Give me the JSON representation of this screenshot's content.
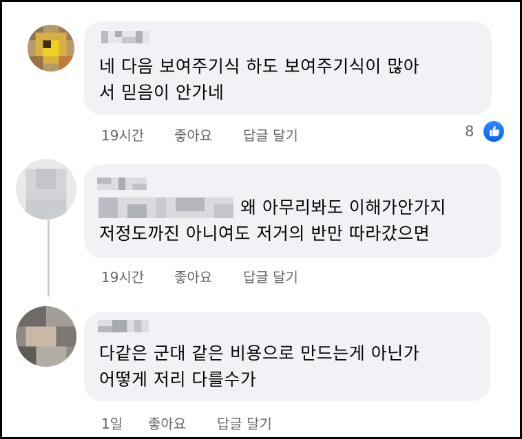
{
  "comments": [
    {
      "message_lines": [
        "네 다음 보여주기식 하도 보여주기식이 많아",
        "서 믿음이 안가네"
      ],
      "time": "19시간",
      "like_label": "좋아요",
      "reply_label": "답글 달기",
      "reaction_count": "8"
    },
    {
      "message_lines": [
        "왜 아무리봐도 이해가안가지",
        "저정도까진 아니여도 저거의 반만 따라갔으면"
      ],
      "time": "19시간",
      "like_label": "좋아요",
      "reply_label": "답글 달기"
    },
    {
      "message_lines": [
        "다같은 군대 같은 비용으로 만드는게 아닌가",
        "어떻게 저리 다를수가"
      ],
      "time": "1일",
      "like_label": "좋아요",
      "reply_label": "답글 달기"
    }
  ],
  "colors": {
    "bubble": "#f0f2f5",
    "meta_text": "#65676b",
    "like_blue": "#1877f2"
  },
  "icons": {
    "reaction": "thumbs-up-icon"
  }
}
